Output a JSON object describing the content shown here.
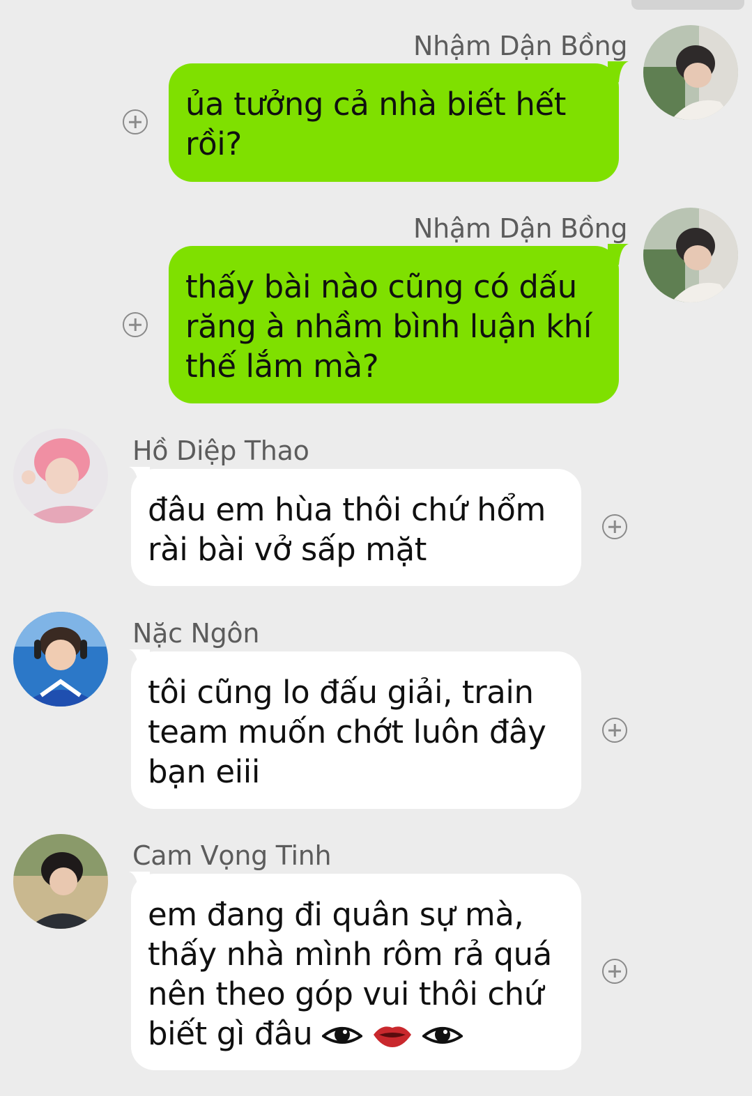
{
  "messages": [
    {
      "sender": "Nhậm Dận Bồng",
      "direction": "outgoing",
      "lines": [
        "ủa tưởng cả nhà biết hết",
        "rồi?"
      ]
    },
    {
      "sender": "Nhậm Dận Bồng",
      "direction": "outgoing",
      "lines": [
        "thấy bài nào cũng có dấu",
        "răng à nhầm bình luận khí",
        "thế lắm mà?"
      ]
    },
    {
      "sender": "Hồ Diệp Thao",
      "direction": "incoming",
      "lines": [
        "đâu em hùa thôi chứ hổm",
        "rài bài vở sấp mặt"
      ]
    },
    {
      "sender": "Nặc Ngôn",
      "direction": "incoming",
      "lines": [
        "tôi cũng lo đấu giải, train",
        "team muốn chớt luôn đây",
        "bạn eiii"
      ]
    },
    {
      "sender": "Cam Vọng Tinh",
      "direction": "incoming",
      "lines": [
        "em đang đi quân sự mà,",
        "thấy nhà mình rôm rả quá",
        "nên  theo góp vui thôi chứ",
        "biết gì đâu"
      ],
      "trailing_emojis": [
        "eye-emoji",
        "lips-emoji",
        "eye-emoji"
      ]
    }
  ],
  "colors": {
    "background": "#ececec",
    "outgoing_bubble": "#7fe000",
    "incoming_bubble": "#ffffff",
    "name_text": "#5c5c5c",
    "message_text": "#101010",
    "add_reaction_icon": "#8a8a8a"
  },
  "icons": [
    "add-reaction-icon"
  ]
}
